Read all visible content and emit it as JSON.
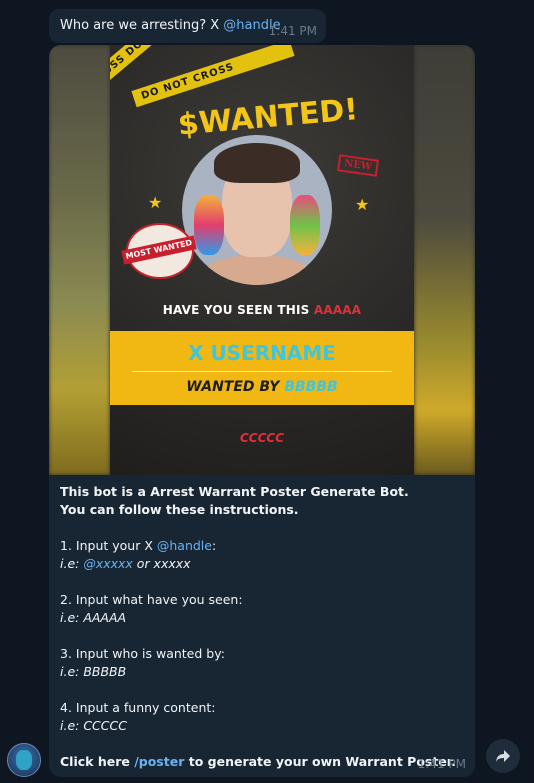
{
  "top_message": {
    "text_prefix": "Who are we arresting? X ",
    "handle": "@handle",
    "time": "1:41 PM"
  },
  "poster": {
    "tape_text": "DO NOT CROSS",
    "tape_text2": "CROSS DO NOT CROSS",
    "title": "$WANTED!",
    "new_badge": "NEW",
    "stamp_top": "MOST WANTED",
    "stamp_band": "MOST WANTED",
    "have_seen_prefix": "HAVE YOU SEEN THIS ",
    "have_seen_value": "AAAAA",
    "username": "X USERNAME",
    "wanted_by_prefix": "WANTED BY ",
    "wanted_by_value": "BBBBB",
    "funny": "CCCCC"
  },
  "caption": {
    "line1": "This bot is a Arrest Warrant Poster Generate Bot.",
    "line2": "You can follow these instructions.",
    "step1": "1. Input your X ",
    "step1_link": "@handle",
    "step1_colon": ":",
    "step1_ex_prefix": "i.e: ",
    "step1_ex_link": "@xxxxx",
    "step1_ex_suffix": " or xxxxx",
    "step2": "2. Input what have you seen:",
    "step2_ex": "i.e: AAAAA",
    "step3": "3. Input who is wanted by:",
    "step3_ex": "i.e: BBBBB",
    "step4": "4. Input a funny content:",
    "step4_ex": "i.e: CCCCC",
    "cta_prefix": "Click here ",
    "cta_link": "/poster",
    "cta_suffix": " to generate your own Warrant Poster.",
    "time": "1:41 PM"
  },
  "colors": {
    "background": "#0e1621",
    "bubble": "#182533",
    "link": "#6ab3f3",
    "poster_yellow": "#f1b712",
    "poster_red": "#e0303a",
    "poster_cyan": "#3fc6df"
  },
  "icons": {
    "share": "share-arrow-icon",
    "avatar": "user-avatar"
  }
}
